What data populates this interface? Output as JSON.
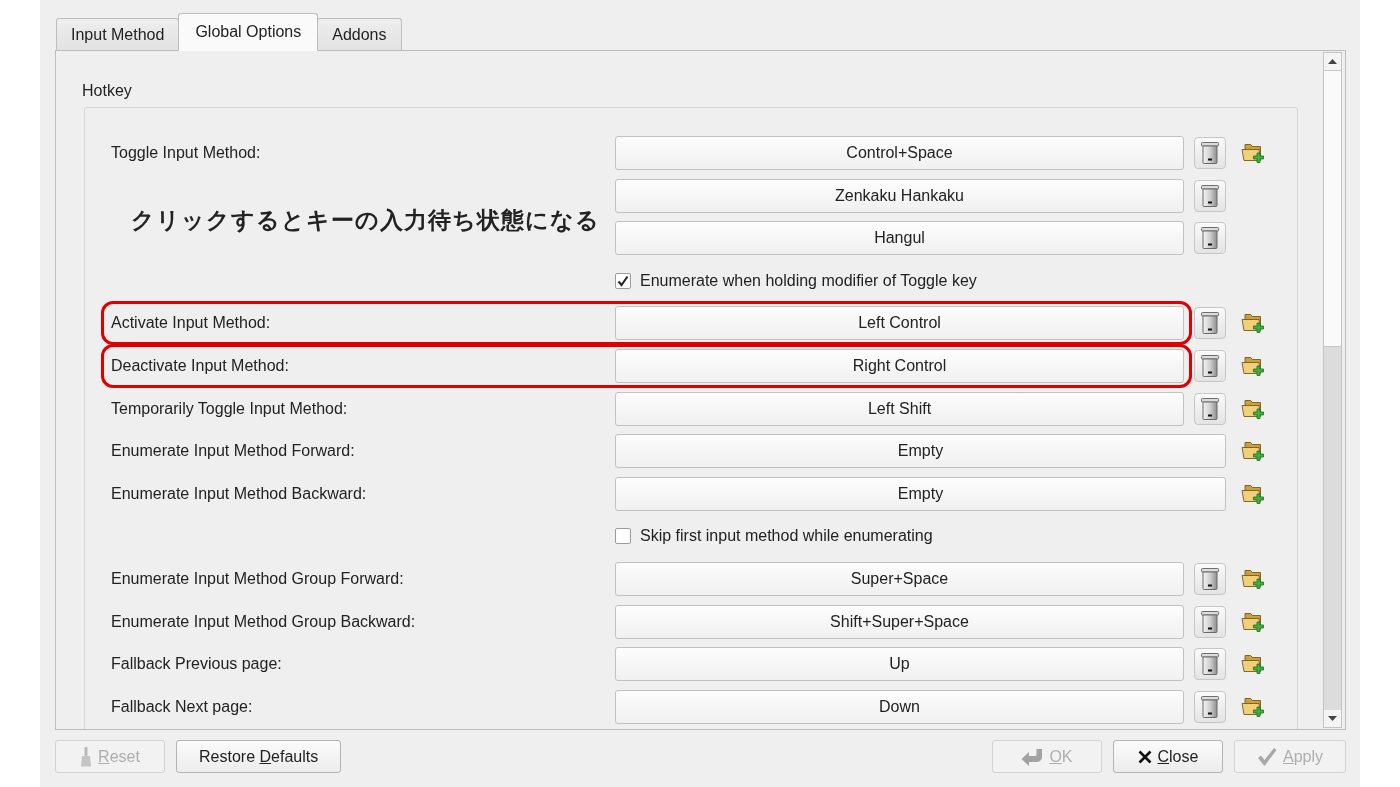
{
  "tabs": [
    {
      "label": "Input Method",
      "selected": false
    },
    {
      "label": "Global Options",
      "selected": true
    },
    {
      "label": "Addons",
      "selected": false
    }
  ],
  "section_title": "Hotkey",
  "rows": [
    {
      "kind": "hotkey",
      "label": "Toggle Input Method:",
      "highlighted": false,
      "annotation": "クリックするとキーの入力待ち状態になる",
      "keys": [
        {
          "value": "Control+Space",
          "deletable": true,
          "addable": true
        },
        {
          "value": "Zenkaku Hankaku",
          "deletable": true,
          "addable": false
        },
        {
          "value": "Hangul",
          "deletable": true,
          "addable": false
        }
      ]
    },
    {
      "kind": "checkbox",
      "label": "Enumerate when holding modifier of Toggle key",
      "checked": true
    },
    {
      "kind": "hotkey",
      "label": "Activate Input Method:",
      "highlighted": true,
      "keys": [
        {
          "value": "Left Control",
          "deletable": true,
          "addable": true
        }
      ]
    },
    {
      "kind": "hotkey",
      "label": "Deactivate Input Method:",
      "highlighted": true,
      "keys": [
        {
          "value": "Right Control",
          "deletable": true,
          "addable": true
        }
      ]
    },
    {
      "kind": "hotkey",
      "label": "Temporarily Toggle Input Method:",
      "highlighted": false,
      "keys": [
        {
          "value": "Left Shift",
          "deletable": true,
          "addable": true
        }
      ]
    },
    {
      "kind": "hotkey",
      "label": "Enumerate Input Method Forward:",
      "highlighted": false,
      "keys": [
        {
          "value": "Empty",
          "deletable": false,
          "addable": true
        }
      ]
    },
    {
      "kind": "hotkey",
      "label": "Enumerate Input Method Backward:",
      "highlighted": false,
      "keys": [
        {
          "value": "Empty",
          "deletable": false,
          "addable": true
        }
      ]
    },
    {
      "kind": "checkbox",
      "label": "Skip first input method while enumerating",
      "checked": false
    },
    {
      "kind": "hotkey",
      "label": "Enumerate Input Method Group Forward:",
      "highlighted": false,
      "keys": [
        {
          "value": "Super+Space",
          "deletable": true,
          "addable": true
        }
      ]
    },
    {
      "kind": "hotkey",
      "label": "Enumerate Input Method Group Backward:",
      "highlighted": false,
      "keys": [
        {
          "value": "Shift+Super+Space",
          "deletable": true,
          "addable": true
        }
      ]
    },
    {
      "kind": "hotkey",
      "label": "Fallback Previous page:",
      "highlighted": false,
      "keys": [
        {
          "value": "Up",
          "deletable": true,
          "addable": true
        }
      ]
    },
    {
      "kind": "hotkey",
      "label": "Fallback Next page:",
      "highlighted": false,
      "keys": [
        {
          "value": "Down",
          "deletable": true,
          "addable": true
        }
      ]
    }
  ],
  "left_buttons": [
    {
      "kind": "reset",
      "mnemonic": "R",
      "after": "eset",
      "disabled": true
    },
    {
      "kind": "restore",
      "before": "Restore ",
      "mnemonic": "D",
      "after": "efaults",
      "disabled": false
    }
  ],
  "right_buttons": [
    {
      "kind": "ok",
      "mnemonic": "O",
      "after": "K",
      "disabled": true
    },
    {
      "kind": "close",
      "mnemonic": "C",
      "after": "lose",
      "disabled": false
    },
    {
      "kind": "apply",
      "mnemonic": "A",
      "after": "pply",
      "disabled": true
    }
  ]
}
